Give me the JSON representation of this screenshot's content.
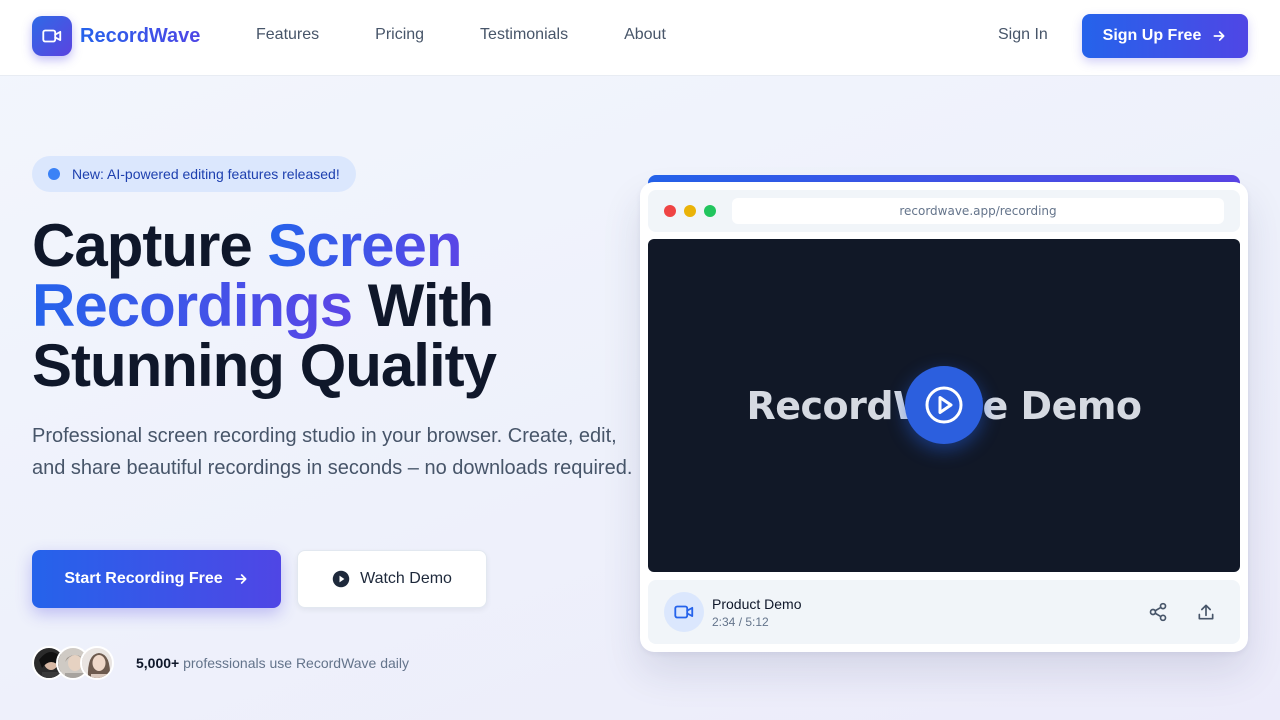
{
  "brand": {
    "name": "RecordWave",
    "logo_icon": "video-camera-icon"
  },
  "nav": {
    "items": [
      {
        "label": "Features"
      },
      {
        "label": "Pricing"
      },
      {
        "label": "Testimonials"
      },
      {
        "label": "About"
      }
    ],
    "sign_in": "Sign In",
    "sign_up": "Sign Up Free"
  },
  "hero": {
    "badge": "New: AI-powered editing features released!",
    "headline": {
      "part1": "Capture ",
      "highlight1": "Screen",
      "highlight2": "Recordings",
      "part2": " With",
      "line3": "Stunning Quality"
    },
    "subtitle": "Professional screen recording studio in your browser. Create, edit, and share beautiful recordings in seconds – no downloads required.",
    "primary_cta": "Start Recording Free",
    "secondary_cta": "Watch Demo",
    "social_proof": {
      "count": "5,000+",
      "text": " professionals use RecordWave daily"
    }
  },
  "mockup": {
    "url": "recordwave.app/recording",
    "video_title": "RecordWave Demo",
    "recording": {
      "title": "Product Demo",
      "time": "2:34 / 5:12"
    }
  },
  "colors": {
    "primary": "#2563eb",
    "accent": "#4f46e5",
    "dark": "#0f172a",
    "video_bg": "#111827",
    "window_red": "#ef4444",
    "window_yellow": "#eab308",
    "window_green": "#22c55e"
  }
}
